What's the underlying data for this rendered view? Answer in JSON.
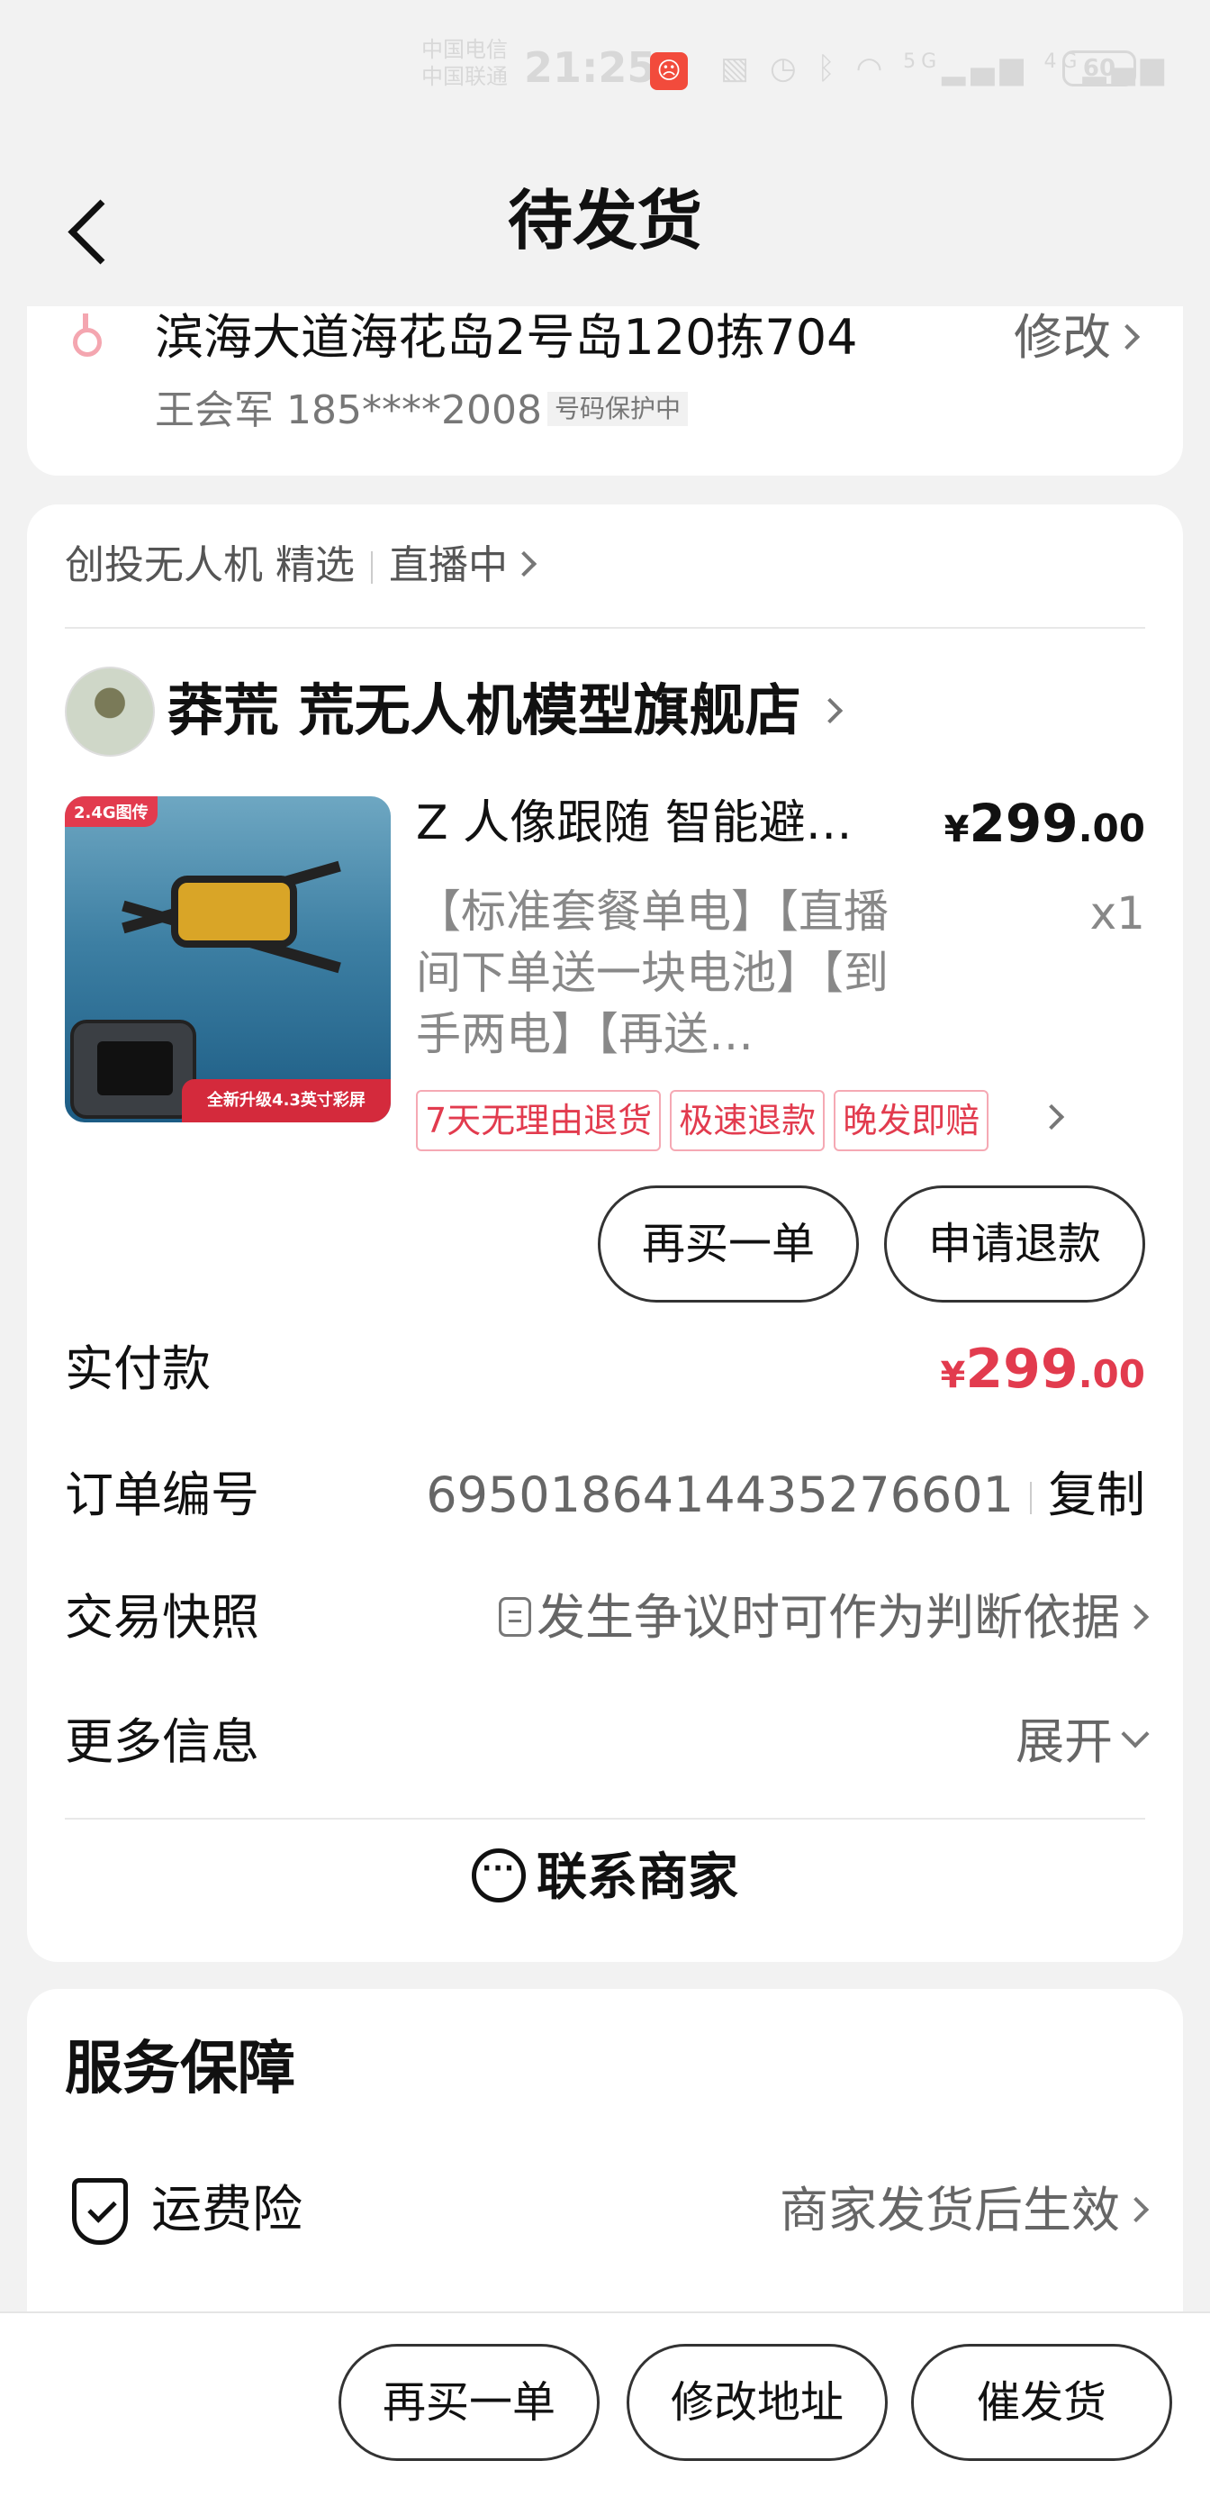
{
  "status_bar": {
    "carrier_1": "中国电信",
    "carrier_2": "中国联通",
    "time": "21:25",
    "network": "5G",
    "network_2": "4G",
    "battery": "60"
  },
  "header": {
    "title": "待发货"
  },
  "address": {
    "line": "滨海大道海花岛2号岛120拣704",
    "modify_label": "修改",
    "recipient": "王会军 185****2008",
    "protect_label": "号码保护中"
  },
  "order": {
    "channel_label": "创投无人机 精选",
    "live_label": "直播中",
    "shop_name": "莽荒 荒无人机模型旗舰店",
    "product_title": "Z 人像跟随 智能避…",
    "product_image_tag": "2.4G图传",
    "product_image_banner": "全新升级4.3英寸彩屏",
    "price_symbol": "¥",
    "price_int": "299",
    "price_dec": ".00",
    "spec": "【标准套餐单电】【直播间下单送一块电池】【到手两电】【再送…",
    "quantity": "x1",
    "badges": [
      "7天无理由退货",
      "极速退款",
      "晚发即赔"
    ],
    "buy_again_label": "再买一单",
    "refund_label": "申请退款",
    "paid_label": "实付款",
    "paid_symbol": "¥",
    "paid_int": "299",
    "paid_dec": ".00",
    "order_no_label": "订单编号",
    "order_no": "6950186414435276601",
    "copy_label": "复制",
    "snapshot_label": "交易快照",
    "snapshot_value": "发生争议时可作为判断依据",
    "more_info_label": "更多信息",
    "expand_label": "展开",
    "contact_label": "联系商家"
  },
  "service": {
    "title": "服务保障",
    "item_label": "运费险",
    "item_value": "商家发货后生效"
  },
  "bottom_bar": {
    "buy_again": "再买一单",
    "modify_address": "修改地址",
    "urge_ship": "催发货"
  },
  "colors": {
    "accent": "#e23b4e",
    "background": "#f2f2f2"
  }
}
